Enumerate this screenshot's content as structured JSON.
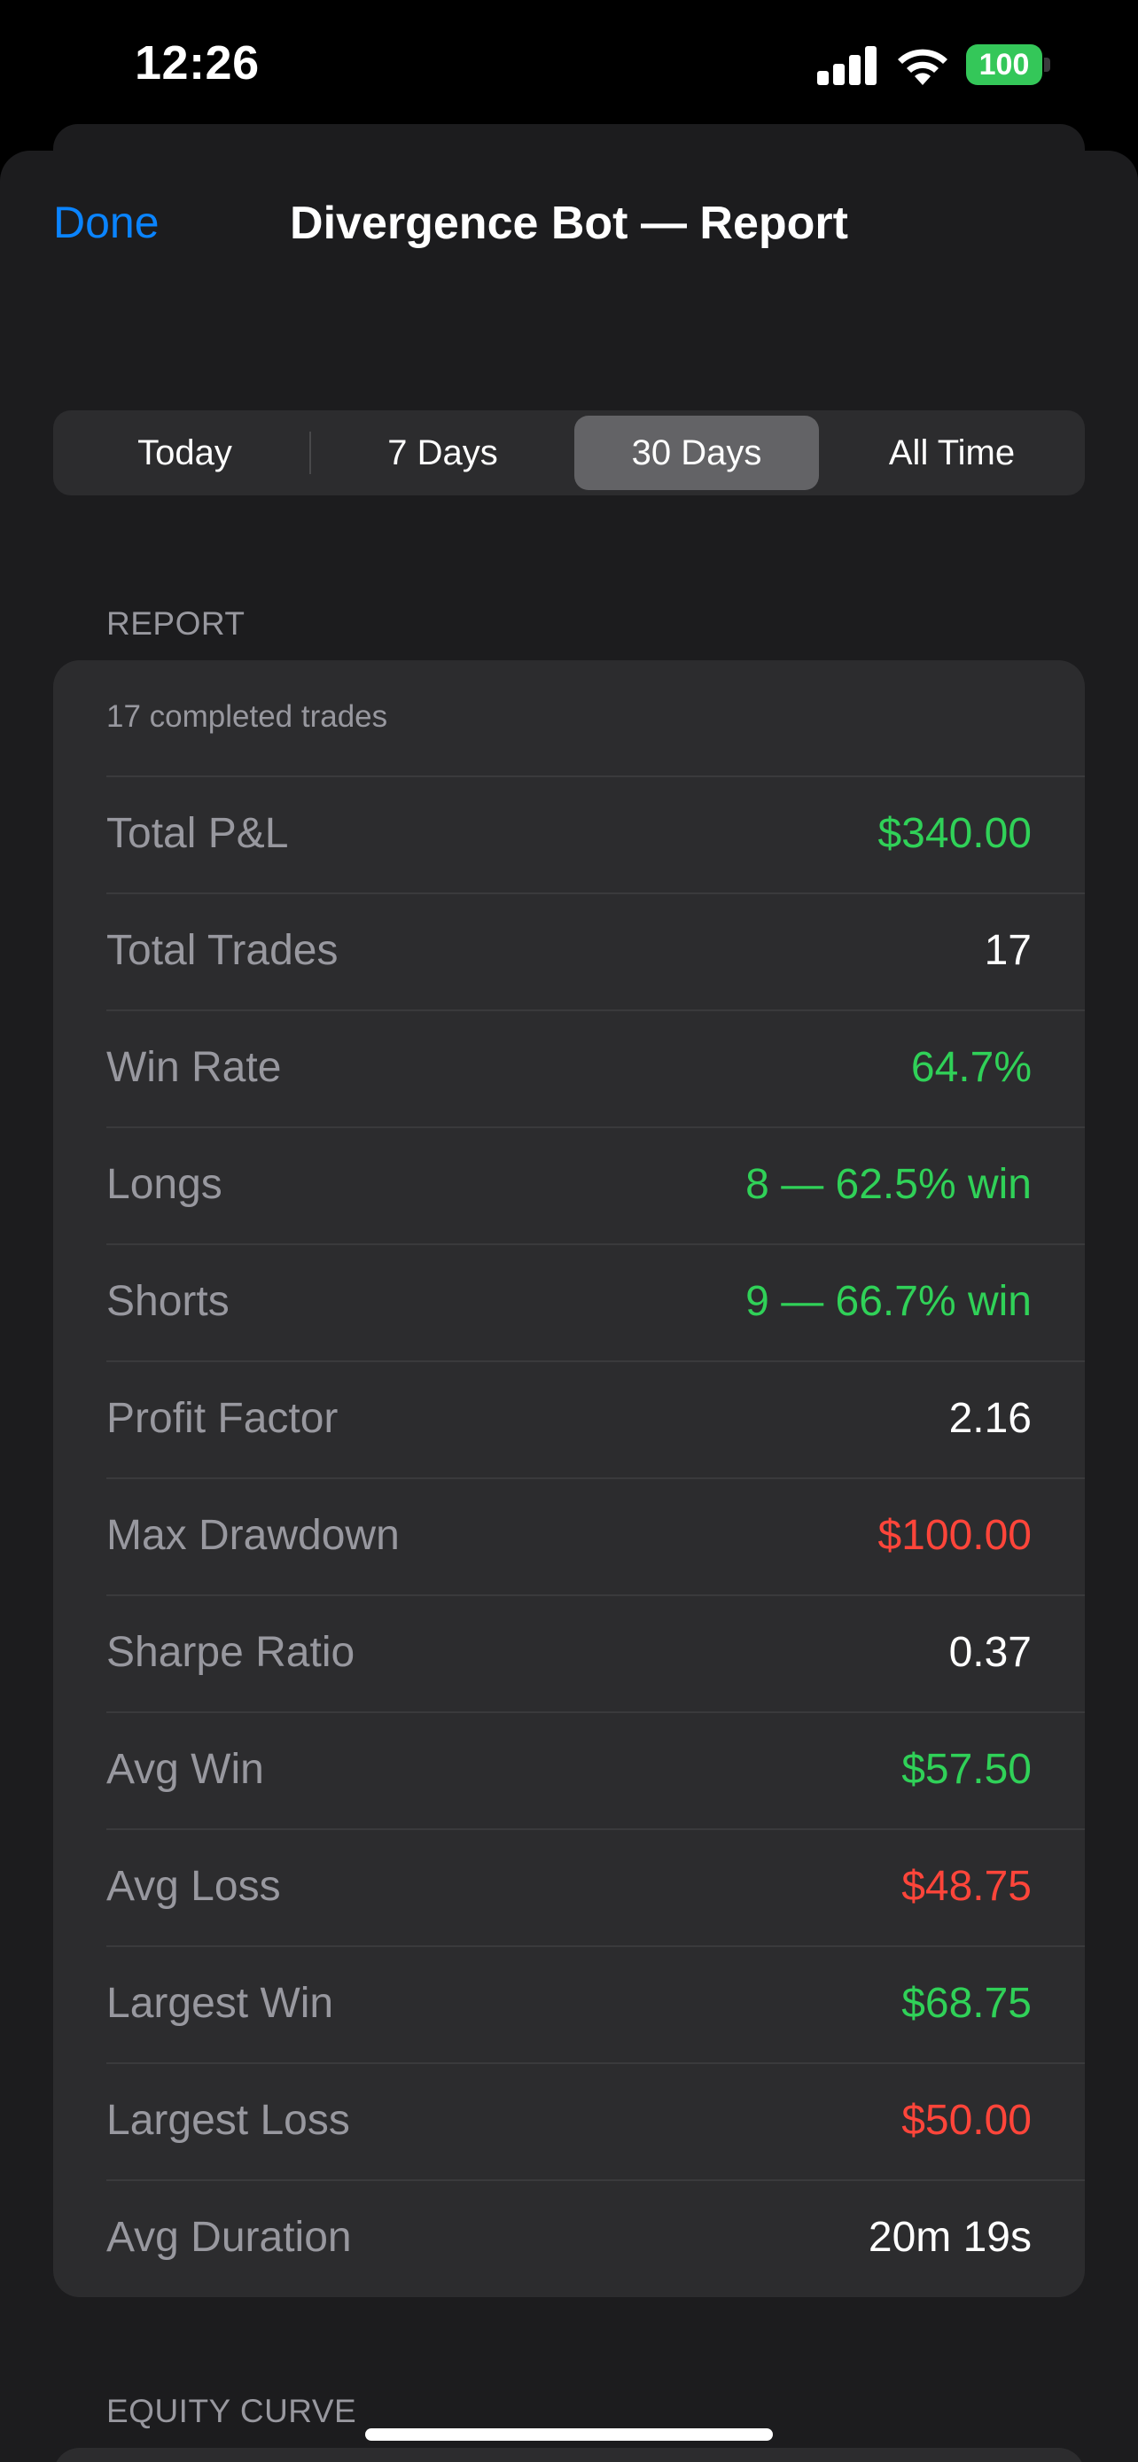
{
  "status_bar": {
    "time": "12:26",
    "battery": "100"
  },
  "nav": {
    "done_label": "Done",
    "title": "Divergence Bot — Report"
  },
  "segments": [
    {
      "label": "Today",
      "selected": false
    },
    {
      "label": "7 Days",
      "selected": false
    },
    {
      "label": "30 Days",
      "selected": true
    },
    {
      "label": "All Time",
      "selected": false
    }
  ],
  "report": {
    "header": "REPORT",
    "note": "17 completed trades",
    "rows": [
      {
        "label": "Total P&L",
        "value": "$340.00",
        "color": "#30d158"
      },
      {
        "label": "Total Trades",
        "value": "17",
        "color": "#ffffff"
      },
      {
        "label": "Win Rate",
        "value": "64.7%",
        "color": "#30d158"
      },
      {
        "label": "Longs",
        "value": "8 — 62.5% win",
        "color": "#30d158"
      },
      {
        "label": "Shorts",
        "value": "9 — 66.7% win",
        "color": "#30d158"
      },
      {
        "label": "Profit Factor",
        "value": "2.16",
        "color": "#ffffff"
      },
      {
        "label": "Max Drawdown",
        "value": "$100.00",
        "color": "#ff453a"
      },
      {
        "label": "Sharpe Ratio",
        "value": "0.37",
        "color": "#ffffff"
      },
      {
        "label": "Avg Win",
        "value": "$57.50",
        "color": "#30d158"
      },
      {
        "label": "Avg Loss",
        "value": "$48.75",
        "color": "#ff453a"
      },
      {
        "label": "Largest Win",
        "value": "$68.75",
        "color": "#30d158"
      },
      {
        "label": "Largest Loss",
        "value": "$50.00",
        "color": "#ff453a"
      },
      {
        "label": "Avg Duration",
        "value": "20m 19s",
        "color": "#ffffff"
      }
    ]
  },
  "equity": {
    "header": "EQUITY CURVE"
  },
  "colors": {
    "accent": "#0a84ff",
    "positive": "#30d158",
    "negative": "#ff453a"
  }
}
